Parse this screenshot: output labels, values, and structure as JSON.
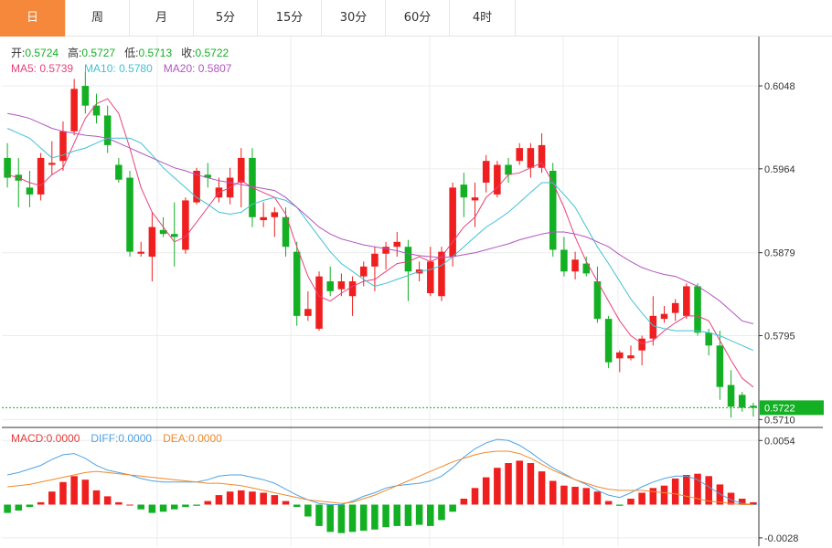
{
  "tabs": [
    {
      "label": "日",
      "active": true
    },
    {
      "label": "周",
      "active": false
    },
    {
      "label": "月",
      "active": false
    },
    {
      "label": "5分",
      "active": false
    },
    {
      "label": "15分",
      "active": false
    },
    {
      "label": "30分",
      "active": false
    },
    {
      "label": "60分",
      "active": false
    },
    {
      "label": "4时",
      "active": false
    }
  ],
  "info": {
    "open_label": "开:",
    "open": "0.5724",
    "high_label": "高:",
    "high": "0.5727",
    "low_label": "低:",
    "low": "0.5713",
    "close_label": "收:",
    "close": "0.5722"
  },
  "ma_legend": [
    {
      "label": "MA5: 0.5739",
      "color": "#e8417a"
    },
    {
      "label": "MA10: 0.5780",
      "color": "#3fc1d4"
    },
    {
      "label": "MA20: 0.5807",
      "color": "#b155c0"
    }
  ],
  "macd_legend": [
    {
      "label": "MACD:0.0000",
      "color": "#e83a3a"
    },
    {
      "label": "DIFF:0.0000",
      "color": "#4ea3e6"
    },
    {
      "label": "DEA:0.0000",
      "color": "#f08a2c"
    }
  ],
  "current_price": "0.5722",
  "colors": {
    "up": "#f01f1f",
    "down": "#13b024",
    "grid": "#ececec",
    "axis": "#333333"
  },
  "chart_data": [
    {
      "type": "candlestick",
      "price_ticks": [
        "0.6048",
        "0.5964",
        "0.5879",
        "0.5795",
        "0.5710"
      ],
      "ylim": [
        0.5702,
        0.6098
      ],
      "current_price": 0.5722,
      "candles": [
        [
          0.5975,
          0.599,
          0.5945,
          0.5955
        ],
        [
          0.5958,
          0.5975,
          0.5925,
          0.5952
        ],
        [
          0.5945,
          0.5962,
          0.5925,
          0.5938
        ],
        [
          0.5938,
          0.598,
          0.5932,
          0.5975
        ],
        [
          0.5968,
          0.5992,
          0.5958,
          0.597
        ],
        [
          0.5972,
          0.6012,
          0.5962,
          0.6002
        ],
        [
          0.6002,
          0.6055,
          0.5998,
          0.6045
        ],
        [
          0.6048,
          0.6062,
          0.602,
          0.6028
        ],
        [
          0.6028,
          0.604,
          0.601,
          0.6018
        ],
        [
          0.6018,
          0.6028,
          0.598,
          0.5988
        ],
        [
          0.5968,
          0.5975,
          0.595,
          0.5953
        ],
        [
          0.5955,
          0.5962,
          0.5875,
          0.588
        ],
        [
          0.5878,
          0.589,
          0.5875,
          0.588
        ],
        [
          0.5875,
          0.592,
          0.585,
          0.5905
        ],
        [
          0.5902,
          0.5915,
          0.5895,
          0.5898
        ],
        [
          0.5898,
          0.593,
          0.5865,
          0.5895
        ],
        [
          0.5882,
          0.5935,
          0.5878,
          0.5932
        ],
        [
          0.593,
          0.5965,
          0.5928,
          0.5962
        ],
        [
          0.5958,
          0.597,
          0.5945,
          0.5955
        ],
        [
          0.5935,
          0.5955,
          0.593,
          0.5945
        ],
        [
          0.5935,
          0.5965,
          0.5928,
          0.5955
        ],
        [
          0.595,
          0.5985,
          0.5925,
          0.5975
        ],
        [
          0.5975,
          0.5985,
          0.5905,
          0.5915
        ],
        [
          0.5912,
          0.593,
          0.5905,
          0.5915
        ],
        [
          0.5915,
          0.5925,
          0.5895,
          0.592
        ],
        [
          0.5915,
          0.5925,
          0.5875,
          0.5885
        ],
        [
          0.588,
          0.589,
          0.5805,
          0.5815
        ],
        [
          0.5815,
          0.584,
          0.581,
          0.5822
        ],
        [
          0.5802,
          0.586,
          0.58,
          0.5855
        ],
        [
          0.585,
          0.5865,
          0.5835,
          0.584
        ],
        [
          0.5842,
          0.5858,
          0.5835,
          0.585
        ],
        [
          0.5835,
          0.5855,
          0.5815,
          0.585
        ],
        [
          0.5855,
          0.587,
          0.5845,
          0.5865
        ],
        [
          0.5865,
          0.5885,
          0.584,
          0.5878
        ],
        [
          0.5878,
          0.589,
          0.5862,
          0.5885
        ],
        [
          0.5885,
          0.59,
          0.5875,
          0.589
        ],
        [
          0.5885,
          0.5892,
          0.583,
          0.586
        ],
        [
          0.5858,
          0.587,
          0.585,
          0.5862
        ],
        [
          0.5838,
          0.5885,
          0.5835,
          0.587
        ],
        [
          0.5835,
          0.5885,
          0.583,
          0.588
        ],
        [
          0.5875,
          0.595,
          0.5865,
          0.5945
        ],
        [
          0.5948,
          0.596,
          0.5915,
          0.5935
        ],
        [
          0.5932,
          0.595,
          0.5905,
          0.5935
        ],
        [
          0.595,
          0.5978,
          0.594,
          0.5972
        ],
        [
          0.5938,
          0.5972,
          0.5935,
          0.5968
        ],
        [
          0.5968,
          0.5975,
          0.595,
          0.5958
        ],
        [
          0.5972,
          0.599,
          0.5968,
          0.5985
        ],
        [
          0.5965,
          0.599,
          0.5955,
          0.5985
        ],
        [
          0.5965,
          0.6,
          0.596,
          0.5988
        ],
        [
          0.5962,
          0.597,
          0.5875,
          0.5882
        ],
        [
          0.5882,
          0.5895,
          0.5855,
          0.586
        ],
        [
          0.586,
          0.588,
          0.5852,
          0.5872
        ],
        [
          0.5868,
          0.5875,
          0.5855,
          0.5858
        ],
        [
          0.585,
          0.5865,
          0.5808,
          0.5812
        ],
        [
          0.5812,
          0.5815,
          0.5762,
          0.5768
        ],
        [
          0.5772,
          0.578,
          0.5758,
          0.5778
        ],
        [
          0.5772,
          0.5785,
          0.577,
          0.5775
        ],
        [
          0.578,
          0.5795,
          0.5765,
          0.5792
        ],
        [
          0.5792,
          0.5835,
          0.5785,
          0.5815
        ],
        [
          0.5812,
          0.5825,
          0.5808,
          0.5817
        ],
        [
          0.5818,
          0.5832,
          0.581,
          0.5828
        ],
        [
          0.5815,
          0.5848,
          0.5812,
          0.5845
        ],
        [
          0.5845,
          0.5848,
          0.5795,
          0.5798
        ],
        [
          0.5798,
          0.5802,
          0.5775,
          0.5785
        ],
        [
          0.5785,
          0.58,
          0.573,
          0.5743
        ],
        [
          0.5745,
          0.576,
          0.5712,
          0.5723
        ],
        [
          0.5735,
          0.5738,
          0.5718,
          0.5722
        ],
        [
          0.5724,
          0.5727,
          0.5713,
          0.5722
        ]
      ],
      "series": [
        {
          "name": "MA5",
          "color": "#e8417a",
          "values": [
            0.5958,
            0.5955,
            0.595,
            0.5947,
            0.5958,
            0.5965,
            0.599,
            0.6015,
            0.603,
            0.6035,
            0.602,
            0.5985,
            0.5945,
            0.592,
            0.5905,
            0.589,
            0.5895,
            0.591,
            0.5925,
            0.594,
            0.5945,
            0.5952,
            0.5945,
            0.594,
            0.5935,
            0.5918,
            0.5885,
            0.5855,
            0.5835,
            0.583,
            0.5838,
            0.5845,
            0.585,
            0.5852,
            0.586,
            0.5868,
            0.587,
            0.5875,
            0.587,
            0.5875,
            0.589,
            0.5905,
            0.5915,
            0.5935,
            0.5945,
            0.5958,
            0.596,
            0.5965,
            0.597,
            0.595,
            0.5925,
            0.5895,
            0.587,
            0.585,
            0.583,
            0.581,
            0.5795,
            0.5787,
            0.579,
            0.58,
            0.5808,
            0.5815,
            0.5815,
            0.581,
            0.579,
            0.577,
            0.5752,
            0.5743
          ]
        },
        {
          "name": "MA10",
          "color": "#3fc1d4",
          "values": [
            0.6005,
            0.6,
            0.5995,
            0.5985,
            0.5975,
            0.5978,
            0.5982,
            0.5985,
            0.599,
            0.5995,
            0.5995,
            0.5995,
            0.599,
            0.5978,
            0.5965,
            0.5955,
            0.5945,
            0.5935,
            0.5928,
            0.592,
            0.5918,
            0.592,
            0.5928,
            0.5932,
            0.5935,
            0.5932,
            0.5925,
            0.591,
            0.5895,
            0.588,
            0.5868,
            0.586,
            0.5852,
            0.5845,
            0.5848,
            0.5852,
            0.5856,
            0.586,
            0.5862,
            0.5866,
            0.5875,
            0.5885,
            0.5895,
            0.5905,
            0.5912,
            0.592,
            0.593,
            0.594,
            0.595,
            0.595,
            0.5938,
            0.5925,
            0.5905,
            0.5885,
            0.5868,
            0.585,
            0.5832,
            0.5818,
            0.5805,
            0.5802,
            0.58,
            0.58,
            0.58,
            0.5798,
            0.5795,
            0.579,
            0.5785,
            0.578
          ]
        },
        {
          "name": "MA20",
          "color": "#b155c0",
          "values": [
            0.602,
            0.6018,
            0.6015,
            0.601,
            0.6005,
            0.6002,
            0.6,
            0.5998,
            0.5997,
            0.5995,
            0.599,
            0.5985,
            0.598,
            0.5975,
            0.597,
            0.5965,
            0.5962,
            0.5958,
            0.5955,
            0.5952,
            0.595,
            0.5948,
            0.5946,
            0.5944,
            0.5942,
            0.5935,
            0.5925,
            0.5915,
            0.5905,
            0.5898,
            0.5893,
            0.589,
            0.5887,
            0.5885,
            0.5883,
            0.5881,
            0.5878,
            0.5876,
            0.5875,
            0.5874,
            0.5875,
            0.5877,
            0.5879,
            0.5882,
            0.5885,
            0.5888,
            0.5892,
            0.5895,
            0.5898,
            0.59,
            0.59,
            0.5898,
            0.5895,
            0.589,
            0.5885,
            0.5877,
            0.587,
            0.5864,
            0.586,
            0.5857,
            0.5855,
            0.585,
            0.5845,
            0.5838,
            0.583,
            0.582,
            0.581,
            0.5807
          ]
        }
      ]
    },
    {
      "type": "bar",
      "subtype": "macd",
      "value_ticks": [
        "0.0054",
        "-0.0028"
      ],
      "ylim": [
        -0.0035,
        0.0065
      ],
      "macd": [
        -0.0007,
        -0.0005,
        -0.0002,
        0.0002,
        0.0011,
        0.0019,
        0.0024,
        0.0021,
        0.0012,
        0.0007,
        0.0002,
        0.0,
        -0.0004,
        -0.0007,
        -0.0006,
        -0.0004,
        -0.0002,
        -0.0001,
        0.0003,
        0.0008,
        0.0011,
        0.0012,
        0.0011,
        0.001,
        0.0008,
        0.0003,
        -0.0002,
        -0.001,
        -0.0018,
        -0.0023,
        -0.0024,
        -0.0023,
        -0.0022,
        -0.0021,
        -0.0019,
        -0.0018,
        -0.0018,
        -0.0017,
        -0.0018,
        -0.0013,
        -0.0006,
        0.0005,
        0.0014,
        0.0023,
        0.0031,
        0.0035,
        0.0037,
        0.0035,
        0.0028,
        0.002,
        0.0016,
        0.0015,
        0.0014,
        0.0011,
        0.0003,
        -0.0001,
        0.0005,
        0.001,
        0.0014,
        0.0016,
        0.0022,
        0.0025,
        0.0026,
        0.0024,
        0.0017,
        0.001,
        0.0005,
        0.0002
      ],
      "diff": [
        0.0025,
        0.0027,
        0.003,
        0.0033,
        0.0038,
        0.0042,
        0.0043,
        0.0039,
        0.0033,
        0.0029,
        0.0027,
        0.0025,
        0.0022,
        0.002,
        0.0019,
        0.0019,
        0.0019,
        0.0019,
        0.0021,
        0.0024,
        0.0025,
        0.0025,
        0.0023,
        0.0021,
        0.0018,
        0.0013,
        0.0008,
        0.0004,
        0.0001,
        0.0,
        0.0,
        0.0003,
        0.0007,
        0.001,
        0.0014,
        0.0016,
        0.0017,
        0.0018,
        0.002,
        0.0024,
        0.0031,
        0.004,
        0.0047,
        0.0052,
        0.0055,
        0.0054,
        0.005,
        0.0044,
        0.0037,
        0.0031,
        0.0026,
        0.0021,
        0.0017,
        0.0012,
        0.0008,
        0.0006,
        0.001,
        0.0015,
        0.0019,
        0.0022,
        0.0024,
        0.0024,
        0.0021,
        0.0015,
        0.0009,
        0.0004,
        0.0001,
        0.0
      ],
      "dea": [
        0.0015,
        0.0016,
        0.0017,
        0.0019,
        0.0021,
        0.0023,
        0.0025,
        0.0027,
        0.0028,
        0.0027,
        0.0026,
        0.0025,
        0.0024,
        0.0023,
        0.0022,
        0.0021,
        0.002,
        0.0019,
        0.0018,
        0.0018,
        0.0017,
        0.0016,
        0.0014,
        0.0012,
        0.001,
        0.0008,
        0.0006,
        0.0004,
        0.0003,
        0.0002,
        0.0001,
        0.0002,
        0.0005,
        0.0008,
        0.0012,
        0.0016,
        0.002,
        0.0024,
        0.0028,
        0.0032,
        0.0036,
        0.0039,
        0.0042,
        0.0044,
        0.0045,
        0.0045,
        0.0043,
        0.0039,
        0.0034,
        0.0029,
        0.0025,
        0.0021,
        0.0018,
        0.0015,
        0.0013,
        0.0012,
        0.0012,
        0.0012,
        0.0011,
        0.001,
        0.0009,
        0.0007,
        0.0005,
        0.0003,
        0.0002,
        0.0001,
        0.0,
        0.0
      ]
    }
  ]
}
